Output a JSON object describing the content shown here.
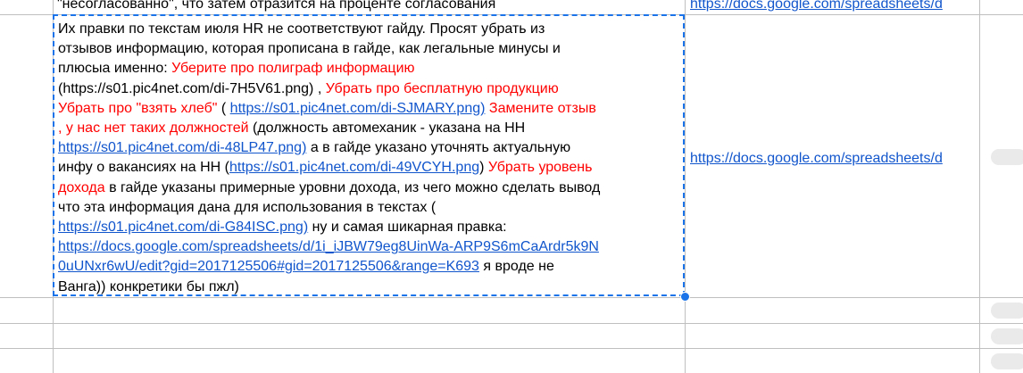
{
  "top_cell": {
    "text": "\"несогласованно\", что затем отразится на проценте согласования",
    "link": "https://docs.google.com/spreadsheets/d"
  },
  "main_cell": {
    "segments": {
      "s1": "Их правки по текстам июля HR  не соответствуют гайду. Просят убрать из",
      "s2": "отзывов информацию, которая прописана в гайде, как легальные минусы и",
      "s3": "плюсыа именно:  ",
      "s4": "Уберите про полиграф информацию",
      "s5": "(https://s01.pic4net.com/di-7H5V61.png) ,    ",
      "s6": "Убрать про бесплатную продукцию",
      "s7": "Убрать про \"взять хлеб\"",
      "s8": " ( ",
      "s9": "https://s01.pic4net.com/di-SJMARY.png)",
      "s10": "  ",
      "s11": "Замените отзыв",
      "s12": ", у нас нет таких должностей",
      "s13": " (должность автомеханик - указана на НН",
      "s14": "https://s01.pic4net.com/di-48LP47.png)",
      "s15": "   а в гайде указано уточнять актуальную",
      "s16": "инфу о вакансиях на НН  (",
      "s17": "https://s01.pic4net.com/di-49VCYH.png",
      "s18": ") ",
      "s19": "Убрать уровень",
      "s20": "дохода",
      "s21": " в гайде указаны примерные уровни дохода, из чего можно сделать вывод",
      "s22": "что эта информация дана для использования в текстах (",
      "s23": "https://s01.pic4net.com/di-G84ISC.png)",
      "s24": "  ну и самая шикарная правка:",
      "s25": "https://docs.google.com/spreadsheets/d/1i_iJBW79eg8UinWa-ARP9S6mCaArdr5k9N",
      "s26": "0uUNxr6wU/edit?gid=2017125506#gid=2017125506&range=K693",
      "s27": "  я вроде не",
      "s28": "Ванга)) конкретики бы пжл)"
    }
  },
  "side_cell": {
    "link": "https://docs.google.com/spreadsheets/d"
  },
  "colors": {
    "link": "#1155cc",
    "highlight": "#ff0000",
    "selection": "#1a73e8",
    "gridline": "#bfbfbf"
  }
}
